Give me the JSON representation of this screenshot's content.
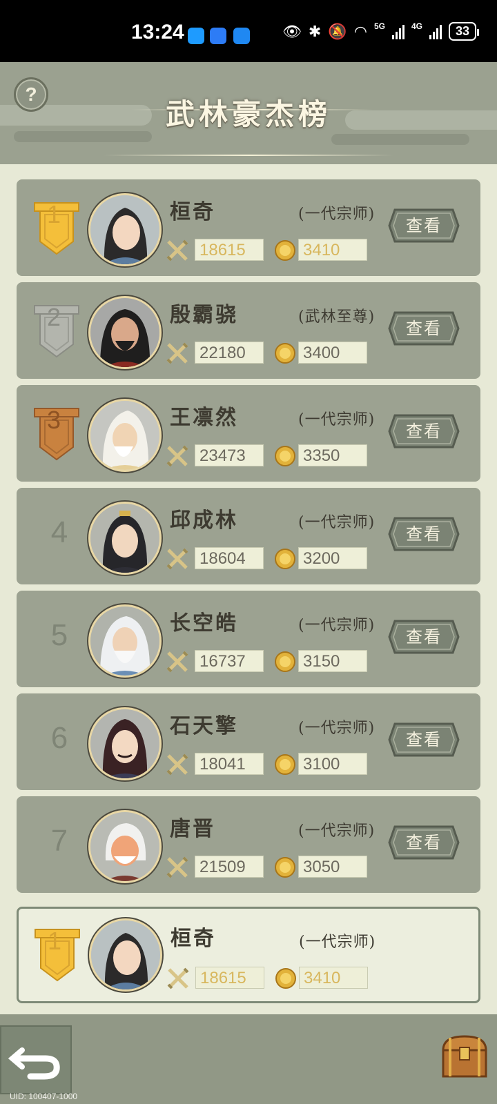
{
  "status_bar": {
    "time": "13:24",
    "network1": "5G",
    "network2": "4G",
    "battery": "33",
    "icons": [
      "message-icon",
      "shield-icon",
      "weather-icon",
      "eye-icon",
      "bluetooth-icon",
      "mute-icon",
      "wifi-icon"
    ]
  },
  "header": {
    "title": "武林豪杰榜",
    "help_label": "?"
  },
  "rows": [
    {
      "rank": "1",
      "name": "桓奇",
      "title": "(一代宗师)",
      "power": "18615",
      "score": "3410",
      "view_label": "查看"
    },
    {
      "rank": "2",
      "name": "殷霸骁",
      "title": "(武林至尊)",
      "power": "22180",
      "score": "3400",
      "view_label": "查看"
    },
    {
      "rank": "3",
      "name": "王凛然",
      "title": "(一代宗师)",
      "power": "23473",
      "score": "3350",
      "view_label": "查看"
    },
    {
      "rank": "4",
      "name": "邱成林",
      "title": "(一代宗师)",
      "power": "18604",
      "score": "3200",
      "view_label": "查看"
    },
    {
      "rank": "5",
      "name": "长空皓",
      "title": "(一代宗师)",
      "power": "16737",
      "score": "3150",
      "view_label": "查看"
    },
    {
      "rank": "6",
      "name": "石天擎",
      "title": "(一代宗师)",
      "power": "18041",
      "score": "3100",
      "view_label": "查看"
    },
    {
      "rank": "7",
      "name": "唐晋",
      "title": "(一代宗师)",
      "power": "21509",
      "score": "3050",
      "view_label": "查看"
    }
  ],
  "self_row": {
    "rank": "1",
    "name": "桓奇",
    "title": "(一代宗师)",
    "power": "18615",
    "score": "3410"
  },
  "footer": {
    "uid": "UID: 100407-1000"
  },
  "colors": {
    "gold": "#f4bf3a",
    "silver": "#b3b5ad",
    "bronze": "#c9823f",
    "panel": "#9ca291",
    "button": "#7d8576"
  }
}
